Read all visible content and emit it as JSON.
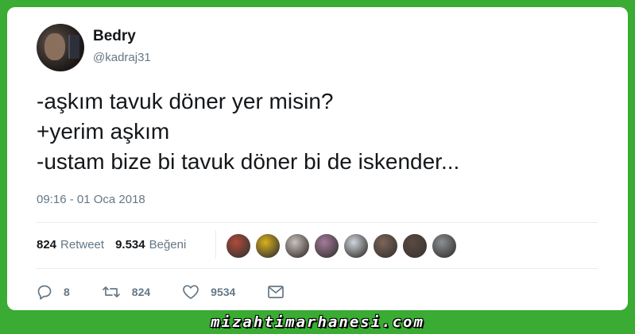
{
  "user": {
    "name": "Bedry",
    "handle": "@kadraj31"
  },
  "tweet": {
    "text": "-aşkım tavuk döner yer misin?\n+yerim aşkım\n-ustam bize bi tavuk döner bi de iskender...",
    "timestamp": "09:16 - 01 Oca 2018"
  },
  "stats": {
    "retweet_count": "824",
    "retweet_label": "Retweet",
    "like_count": "9.534",
    "like_label": "Beğeni"
  },
  "likers": [
    "#b04a3a",
    "#d9b21c",
    "#c9c1ba",
    "#a47b9d",
    "#cfd6de",
    "#7d6458",
    "#5b4a42",
    "#8a8f94"
  ],
  "actions": {
    "reply_count": "8",
    "retweet_count": "824",
    "like_count": "9534"
  },
  "watermark": "mizahtimarhanesi.com",
  "colors": {
    "background": "#3aab33",
    "card": "#ffffff",
    "text": "#14171a",
    "secondary": "#657786"
  }
}
